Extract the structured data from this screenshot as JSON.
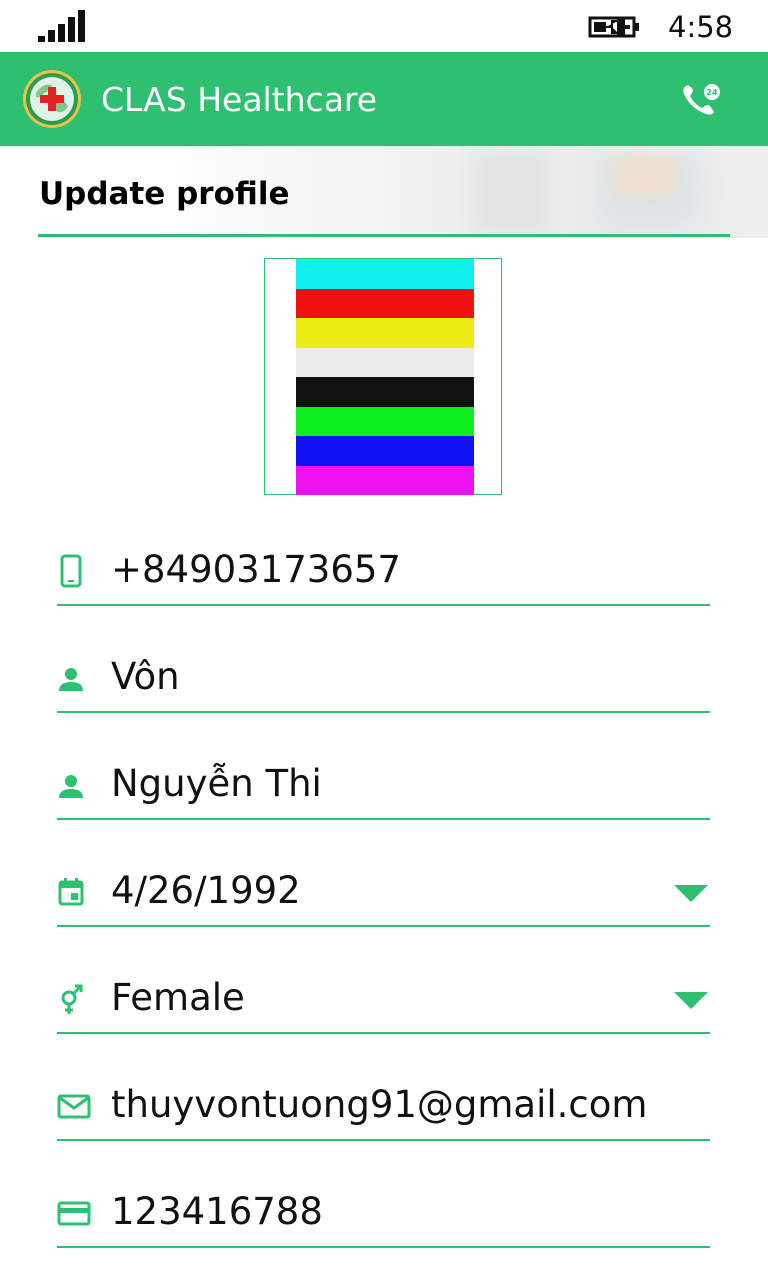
{
  "status_bar": {
    "time": "4:58"
  },
  "app": {
    "title": "CLAS Healthcare",
    "accent": "#2ebf70"
  },
  "page": {
    "title": "Update profile"
  },
  "avatar": {
    "colors": [
      "#0ef0ee",
      "#f01010",
      "#eced12",
      "#ececec",
      "#121212",
      "#0ef01c",
      "#1010f0",
      "#ef12f0"
    ]
  },
  "fields": [
    {
      "icon": "phone-icon",
      "value": "+84903173657"
    },
    {
      "icon": "person-icon",
      "value": "Vôn"
    },
    {
      "icon": "person-icon",
      "value": "Nguyễn Thi"
    },
    {
      "icon": "calendar-icon",
      "value": "4/26/1992"
    },
    {
      "icon": "gender-icon",
      "value": "Female"
    },
    {
      "icon": "email-icon",
      "value": "thuyvontuong91@gmail.com"
    },
    {
      "icon": "card-icon",
      "value": "123416788"
    }
  ]
}
